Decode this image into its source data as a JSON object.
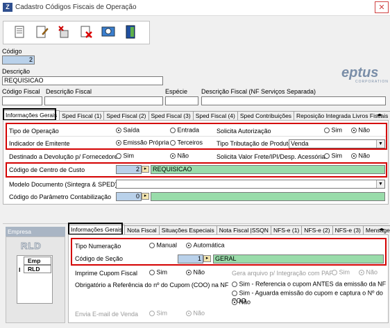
{
  "window": {
    "title": "Cadastro Códigos Fiscais de Operação",
    "close": "✕"
  },
  "header": {
    "codigo_label": "Código",
    "codigo_value": "2",
    "descricao_label": "Descrição",
    "descricao_value": "REQUISICAO",
    "codigo_fiscal_label": "Código Fiscal",
    "descricao_fiscal_label": "Descrição Fiscal",
    "especie_label": "Espécie",
    "descricao_fiscal_nf_label": "Descrição Fiscal (NF Serviços Separada)",
    "logo": "eptus",
    "logo_sub": "CORPORATION"
  },
  "tabs_top": [
    "Informações Gerais",
    "Sped Fiscal (1)",
    "Sped Fiscal (2)",
    "Sped Fiscal (3)",
    "Sped Fiscal (4)",
    "Sped Contribuições",
    "Reposição Integrada Livros Fiscais",
    "M"
  ],
  "general": {
    "tipo_operacao_label": "Tipo de Operação",
    "tipo_operacao_opt1": "Saída",
    "tipo_operacao_opt2": "Entrada",
    "indicador_emitente_label": "Indicador de Emitente",
    "indicador_opt1": "Emissão Própria",
    "indicador_opt2": "Terceiros",
    "solicita_autorizacao_label": "Solicita Autorização",
    "sim": "Sim",
    "nao": "Não",
    "tipo_tributacao_label": "Tipo Tributação de Produtos",
    "tipo_tributacao_value": "Venda",
    "destinado_devolucao_label": "Destinado a Devolução p/ Fornecedores",
    "solicita_valor_label": "Solicita Valor Frete/IPI/Desp. Acessórias",
    "centro_custo_label": "Código de Centro de Custo",
    "centro_custo_code": "2",
    "centro_custo_desc": "REQUISICAO",
    "modelo_documento_label": "Modelo Documento (Sintegra & SPED)",
    "parametro_contabil_label": "Código do Parâmetro Contabilização",
    "parametro_contabil_code": "0"
  },
  "empresa": {
    "title": "Empresa Selecionada",
    "rld": "RLD",
    "col_emp": "Emp",
    "row_marker": "I",
    "row_value": "RLD"
  },
  "tabs_bottom": [
    "Informações Gerais",
    "Nota Fiscal",
    "Situações Especiais",
    "Nota Fiscal |SSQN",
    "NFS-e (1)",
    "NFS-e (2)",
    "NFS-e (3)",
    "Mensage"
  ],
  "bottom": {
    "tipo_numeracao_label": "Tipo Numeração",
    "manual": "Manual",
    "automatica": "Automática",
    "codigo_secao_label": "Código de Seção",
    "codigo_secao_code": "1",
    "codigo_secao_desc": "GERAL",
    "imprime_cupom_label": "Imprime Cupom Fiscal",
    "gera_arquivo_label": "Gera arquivo p/ Integração com PAF",
    "obrigatorio_label": "Obrigatório a Referência do nº do Cupom (COO) na NF",
    "obrig_opt1": "Sim - Referencia o cupom ANTES da emissão da NF",
    "obrig_opt2": "Sim - Aguarda emissão do cupom e captura o Nº do COO",
    "obrig_opt3": "Não",
    "envia_email_label": "Envia E-mail de Venda"
  }
}
